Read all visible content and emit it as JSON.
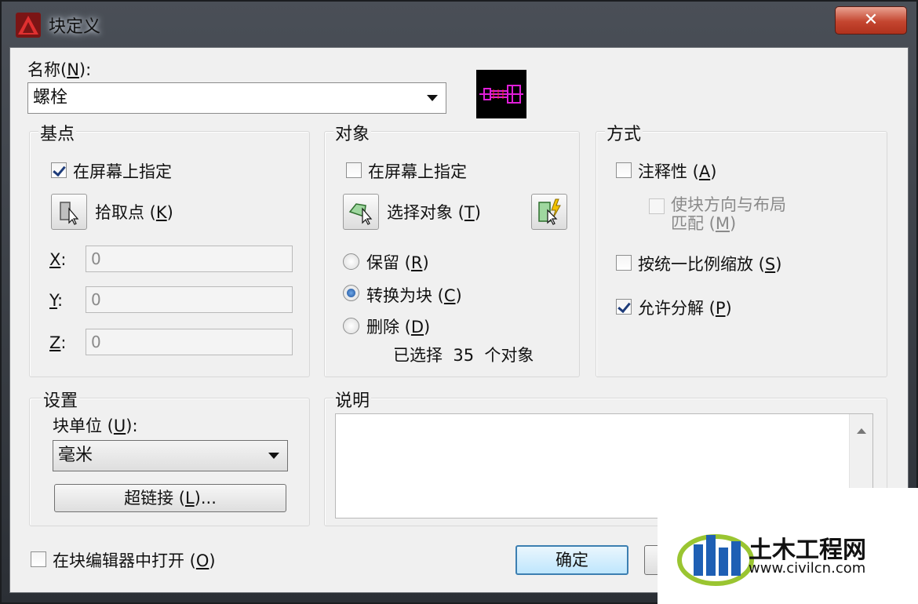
{
  "window": {
    "title": "块定义",
    "close_label": "✕"
  },
  "name": {
    "label": "名称",
    "accel": "N",
    "suffix": ":",
    "value": "螺栓"
  },
  "base_point": {
    "title": "基点",
    "specify_on_screen": "在屏幕上指定",
    "specify_checked": true,
    "pick_point_label": "拾取点",
    "pick_point_accel": "K",
    "x_label": "X",
    "y_label": "Y",
    "z_label": "Z",
    "x_value": "0",
    "y_value": "0",
    "z_value": "0"
  },
  "objects": {
    "title": "对象",
    "specify_on_screen": "在屏幕上指定",
    "specify_checked": false,
    "select_objects_label": "选择对象",
    "select_objects_accel": "T",
    "retain": "保留",
    "retain_accel": "R",
    "convert": "转换为块",
    "convert_accel": "C",
    "delete": "删除",
    "delete_accel": "D",
    "selected_state": "convert",
    "selected_count_text": "已选择  35  个对象"
  },
  "behavior": {
    "title": "方式",
    "annotative": "注释性",
    "annotative_accel": "A",
    "annotative_checked": false,
    "match_orientation": "使块方向与布局",
    "match_orientation_2": "匹配",
    "match_accel": "M",
    "scale_uniformly": "按统一比例缩放",
    "scale_accel": "S",
    "scale_checked": false,
    "allow_explode": "允许分解",
    "explode_accel": "P",
    "explode_checked": true
  },
  "settings": {
    "title": "设置",
    "block_unit_label": "块单位",
    "block_unit_accel": "U",
    "block_unit_suffix": ":",
    "block_unit_value": "毫米",
    "hyperlink_label": "超链接",
    "hyperlink_accel": "L",
    "hyperlink_suffix": "..."
  },
  "description": {
    "title": "说明",
    "value": ""
  },
  "footer": {
    "open_in_editor": "在块编辑器中打开",
    "open_accel": "O",
    "open_checked": false,
    "ok_label": "确定"
  },
  "watermark": {
    "brand": "土木工程网",
    "url": "www.civilcn.com"
  },
  "colors": {
    "accent": "#3c7fb1",
    "title_bar": "#2b2f35",
    "close": "#c4452f",
    "preview_bg": "#000000",
    "preview_block": "#e01ed8"
  }
}
